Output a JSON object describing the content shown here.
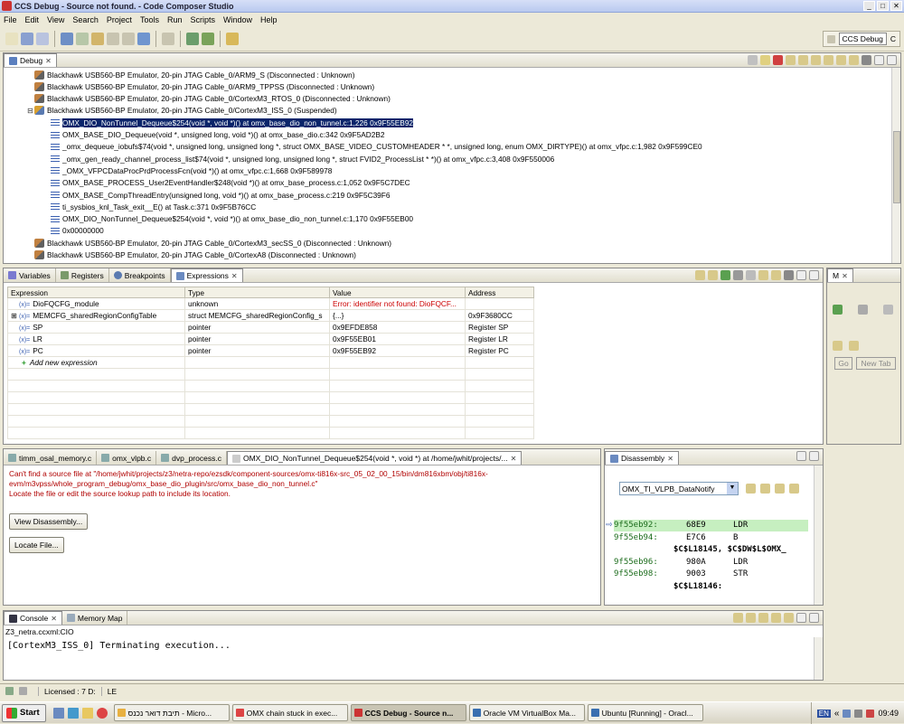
{
  "window": {
    "title": "CCS Debug - Source not found. - Code Composer Studio",
    "btn_min": "_",
    "btn_max": "□",
    "btn_close": "✕"
  },
  "menu": [
    "File",
    "Edit",
    "View",
    "Search",
    "Project",
    "Tools",
    "Run",
    "Scripts",
    "Window",
    "Help"
  ],
  "perspective": {
    "label": "CCS Debug",
    "other": "C"
  },
  "debug_view": {
    "tab": "Debug",
    "rows": [
      {
        "text": "Blackhawk USB560-BP Emulator, 20-pin JTAG Cable_0/ARM9_S (Disconnected : Unknown)",
        "kind": "target"
      },
      {
        "text": "Blackhawk USB560-BP Emulator, 20-pin JTAG Cable_0/ARM9_TPPSS (Disconnected : Unknown)",
        "kind": "target"
      },
      {
        "text": "Blackhawk USB560-BP Emulator, 20-pin JTAG Cable_0/CortexM3_RTOS_0 (Disconnected : Unknown)",
        "kind": "target"
      },
      {
        "text": "Blackhawk USB560-BP Emulator, 20-pin JTAG Cable_0/CortexM3_ISS_0 (Suspended)",
        "kind": "target",
        "expanded": true
      },
      {
        "text": "OMX_DIO_NonTunnel_Dequeue$254(void *, void *)() at omx_base_dio_non_tunnel.c:1,226 0x9F55EB92",
        "kind": "frame",
        "selected": true
      },
      {
        "text": "OMX_BASE_DIO_Dequeue(void *, unsigned long, void *)() at omx_base_dio.c:342 0x9F5AD2B2",
        "kind": "frame"
      },
      {
        "text": "_omx_dequeue_iobufs$74(void *, unsigned long, unsigned long *, struct OMX_BASE_VIDEO_CUSTOMHEADER * *, unsigned long, enum OMX_DIRTYPE)() at omx_vfpc.c:1,982 0x9F599CE0",
        "kind": "frame"
      },
      {
        "text": "_omx_gen_ready_channel_process_list$74(void *, unsigned long, unsigned long *, struct FVID2_ProcessList * *)() at omx_vfpc.c:3,408 0x9F550006",
        "kind": "frame"
      },
      {
        "text": "_OMX_VFPCDataProcPrdProcessFcn(void *)() at omx_vfpc.c:1,668 0x9F589978",
        "kind": "frame"
      },
      {
        "text": "OMX_BASE_PROCESS_User2EventHandler$248(void *)() at omx_base_process.c:1,052 0x9F5C7DEC",
        "kind": "frame"
      },
      {
        "text": "OMX_BASE_CompThreadEntry(unsigned long, void *)() at omx_base_process.c:219 0x9F5C39F6",
        "kind": "frame"
      },
      {
        "text": "ti_sysbios_knl_Task_exit__E() at Task.c:371 0x9F5B76CC",
        "kind": "frame"
      },
      {
        "text": "OMX_DIO_NonTunnel_Dequeue$254(void *, void *)() at omx_base_dio_non_tunnel.c:1,170 0x9F55EB00",
        "kind": "frame"
      },
      {
        "text": "0x00000000",
        "kind": "frame"
      },
      {
        "text": "Blackhawk USB560-BP Emulator, 20-pin JTAG Cable_0/CortexM3_secSS_0 (Disconnected : Unknown)",
        "kind": "target"
      },
      {
        "text": "Blackhawk USB560-BP Emulator, 20-pin JTAG Cable_0/CortexA8 (Disconnected : Unknown)",
        "kind": "target"
      }
    ]
  },
  "mid_tabs": [
    "Variables",
    "Registers",
    "Breakpoints",
    "Expressions"
  ],
  "expressions": {
    "headers": [
      "Expression",
      "Type",
      "Value",
      "Address"
    ],
    "rows": [
      {
        "expr": "DioFQCFG_module",
        "type": "unknown",
        "value": "Error: identifier not found: DioFQCF...",
        "addr": "",
        "error": true,
        "expandable": false
      },
      {
        "expr": "MEMCFG_sharedRegionConfigTable",
        "type": "struct MEMCFG_sharedRegionConfig_s",
        "value": "{...}",
        "addr": "0x9F3680CC",
        "error": false,
        "expandable": true
      },
      {
        "expr": "SP",
        "type": "pointer",
        "value": "0x9EFDE858",
        "addr": "Register SP",
        "error": false,
        "expandable": false
      },
      {
        "expr": "LR",
        "type": "pointer",
        "value": "0x9F55EB01",
        "addr": "Register LR",
        "error": false,
        "expandable": false
      },
      {
        "expr": "PC",
        "type": "pointer",
        "value": "0x9F55EB92",
        "addr": "Register PC",
        "error": false,
        "expandable": false
      }
    ],
    "add_new": "Add new expression"
  },
  "side_panel": {
    "tab": "M",
    "go_label": "Go",
    "newtab_label": "New Tab"
  },
  "editor": {
    "tabs": [
      "timm_osal_memory.c",
      "omx_vlpb.c",
      "dvp_process.c",
      "OMX_DIO_NonTunnel_Dequeue$254(void *, void *) at /home/jwhit/projects/..."
    ],
    "error_lines": [
      "Can't find a source file at \"/home/jwhit/projects/z3/netra-repo/ezsdk/component-sources/omx-ti816x-src_05_02_00_15/bin/dm816xbm/obj/ti816x-",
      "evm/m3vpss/whole_program_debug/omx_base_dio_plugin/src/omx_base_dio_non_tunnel.c\"",
      "Locate the file or edit the source lookup path to include its location."
    ],
    "view_disassembly": "View Disassembly...",
    "locate_file": "Locate File..."
  },
  "disassembly": {
    "tab": "Disassembly",
    "location": "OMX_TI_VLPB_DataNotify",
    "rows": [
      {
        "addr": "9f55eb92:",
        "op": "68E9",
        "mnem": "LDR",
        "current": true
      },
      {
        "addr": "9f55eb94:",
        "op": "E7C6",
        "mnem": "B",
        "current": false
      },
      {
        "label": "$C$L18145, $C$DW$L$OMX_"
      },
      {
        "addr": "9f55eb96:",
        "op": "980A",
        "mnem": "LDR",
        "current": false
      },
      {
        "addr": "9f55eb98:",
        "op": "9003",
        "mnem": "STR",
        "current": false
      },
      {
        "label": "$C$L18146:"
      }
    ]
  },
  "console": {
    "tabs": [
      "Console",
      "Memory Map"
    ],
    "source": "Z3_netra.ccxml:CIO",
    "output": "[CortexM3_ISS_0] Terminating execution..."
  },
  "status": {
    "licensed": "Licensed : 7 D:",
    "mode": "LE"
  },
  "taskbar": {
    "start": "Start",
    "items": [
      {
        "label": "תיבת דואר נכנס - Micro...",
        "active": false
      },
      {
        "label": "OMX chain stuck in exec...",
        "active": false
      },
      {
        "label": "CCS Debug - Source n...",
        "active": true
      },
      {
        "label": "Oracle VM VirtualBox Ma...",
        "active": false
      },
      {
        "label": "Ubuntu [Running] - Oracl...",
        "active": false
      }
    ],
    "lang": "EN",
    "chevrons": "«",
    "clock": "09:49"
  }
}
